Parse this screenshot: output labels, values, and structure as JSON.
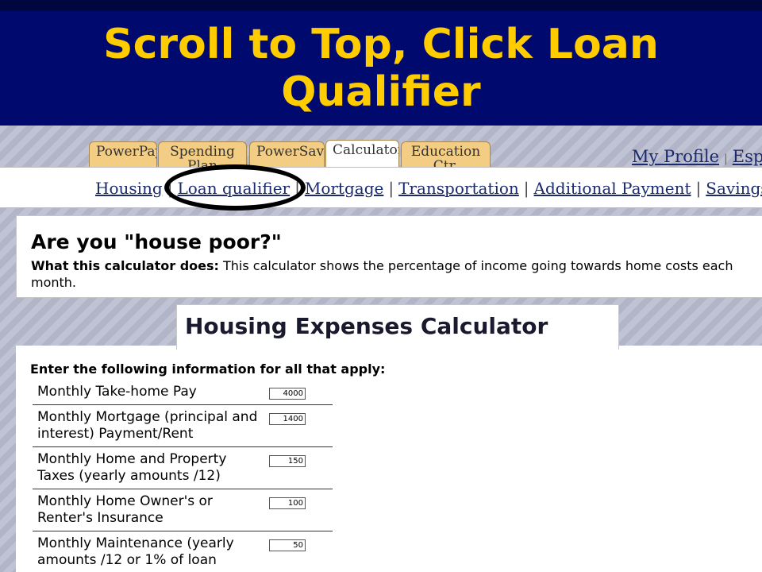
{
  "slide": {
    "title_line1": "Scroll to Top, Click Loan",
    "title_line2": "Qualifier"
  },
  "tabs": [
    {
      "label": "PowerPay"
    },
    {
      "label": "Spending Plan"
    },
    {
      "label": "PowerSaver"
    },
    {
      "label": "Calculators",
      "active": true
    },
    {
      "label": "Education Ctr."
    }
  ],
  "header_links": {
    "profile": "My Profile",
    "separator": "|",
    "spanish": "Español"
  },
  "subnav": [
    {
      "label": "Housing"
    },
    {
      "label": "Loan qualifier",
      "highlighted": true
    },
    {
      "label": "Mortgage"
    },
    {
      "label": "Transportation"
    },
    {
      "label": "Additional Payment"
    },
    {
      "label": "Savings"
    }
  ],
  "subnav_separator": "|",
  "intro": {
    "heading": "Are you \"house poor?\"",
    "desc_label": "What this calculator does:",
    "desc_text": " This calculator shows the percentage of income going towards home costs each month."
  },
  "calculator": {
    "title": "Housing Expenses Calculator",
    "instructions": "Enter the following information for all that apply:",
    "rows": [
      {
        "label": "Monthly Take-home Pay",
        "value": "4000"
      },
      {
        "label": "Monthly Mortgage (principal and interest) Payment/Rent",
        "value": "1400"
      },
      {
        "label": "Monthly Home and Property Taxes (yearly amounts /12)",
        "value": "150"
      },
      {
        "label": "Monthly Home Owner's or Renter's Insurance",
        "value": "100"
      },
      {
        "label": "Monthly Maintenance (yearly amounts /12 or 1% of loan",
        "value": "50"
      }
    ]
  },
  "colors": {
    "banner_bg": "#000a6e",
    "banner_text": "#ffcc00",
    "tab_bg": "#f3cd83",
    "link": "#1a2a6e"
  }
}
